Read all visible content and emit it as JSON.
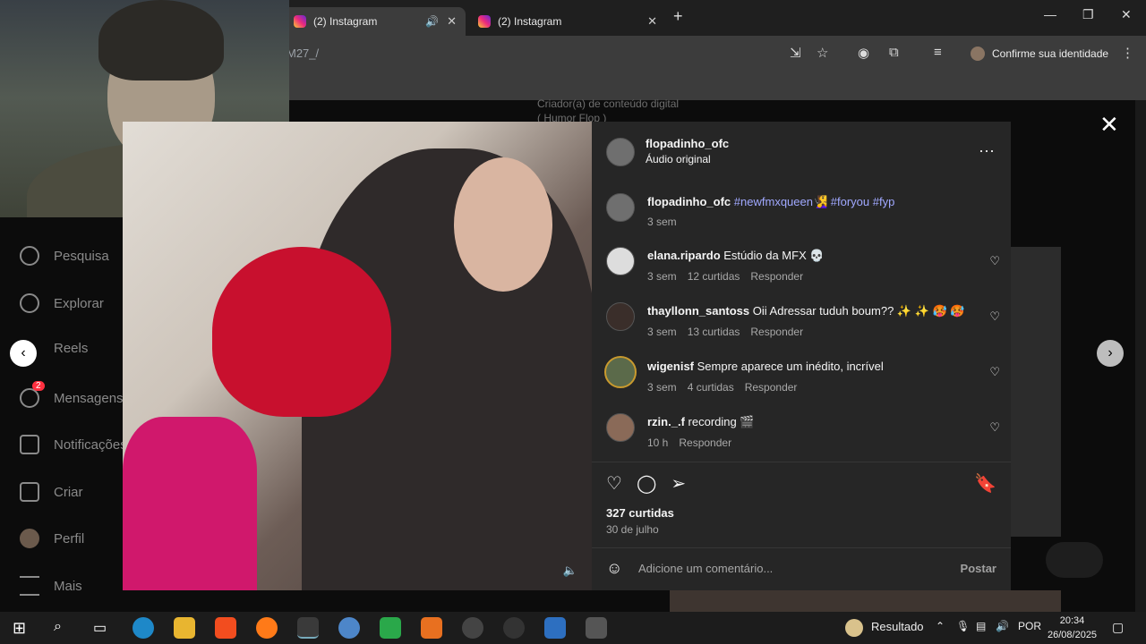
{
  "browser": {
    "tabs": [
      {
        "title": "(2) Instagram",
        "active": true
      },
      {
        "title": "(2) Instagram",
        "active": false
      }
    ],
    "url_fragment": "M27_/",
    "profile_label": "Confirme sua identidade"
  },
  "background": {
    "bio_line1": "Criador(a) de conteúdo digital",
    "bio_line2": "( Humor Flop )"
  },
  "sidebar": {
    "items": [
      {
        "label": "Pesquisa",
        "icon": "search-icon"
      },
      {
        "label": "Explorar",
        "icon": "compass-icon"
      },
      {
        "label": "Reels",
        "icon": "reels-icon"
      },
      {
        "label": "Mensagens",
        "icon": "messenger-icon",
        "badge": "2"
      },
      {
        "label": "Notificações",
        "icon": "heart-icon"
      },
      {
        "label": "Criar",
        "icon": "plus-square-icon"
      },
      {
        "label": "Perfil",
        "icon": "avatar-icon"
      },
      {
        "label": "Mais",
        "icon": "menu-icon"
      }
    ]
  },
  "post": {
    "author": "flopadinho_ofc",
    "audio": "Áudio original",
    "caption_user": "flopadinho_ofc",
    "caption_tags": "#newfmxqueen🧏‍♀️ #foryou #fyp",
    "caption_time": "3 sem",
    "likes": "327 curtidas",
    "date": "30 de julho",
    "comment_placeholder": "Adicione um comentário...",
    "post_button": "Postar",
    "reply_label": "Responder"
  },
  "comments": [
    {
      "user": "elana.ripardo",
      "text": "Estúdio da MFX 💀",
      "time": "3 sem",
      "likes": "12 curtidas"
    },
    {
      "user": "thayllonn_santoss",
      "text": "Oii Adressar tuduh boum?? ✨ ✨ 🥵 🥵",
      "time": "3 sem",
      "likes": "13 curtidas"
    },
    {
      "user": "wigenisf",
      "text": "Sempre aparece um inédito, incrível",
      "time": "3 sem",
      "likes": "4 curtidas"
    },
    {
      "user": "rzin._.f",
      "text": "recording 🎬",
      "time": "10 h",
      "likes": ""
    }
  ],
  "taskbar": {
    "weather": "Resultado",
    "lang": "POR",
    "time": "20:34",
    "date": "26/08/2025"
  }
}
